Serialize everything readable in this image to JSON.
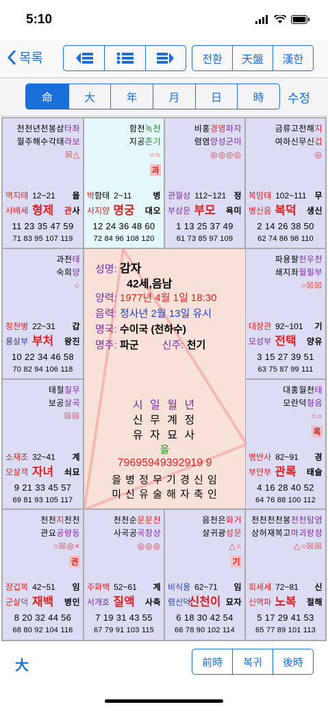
{
  "status": {
    "time": "5:10"
  },
  "nav": {
    "back_label": "목록",
    "right_buttons": [
      "전환",
      "天盤",
      "漢한"
    ]
  },
  "tabs": [
    "命",
    "大",
    "年",
    "月",
    "日",
    "時"
  ],
  "tab_selected": "命",
  "edit_label": "수정",
  "cells": [
    {
      "id": "c0",
      "stars1": [
        [
          "천천년천봉삼",
          "dark"
        ],
        [
          "타좌",
          "purple"
        ]
      ],
      "stars2": [
        [
          "월주해수각태",
          "dark"
        ],
        [
          "라보",
          "purple"
        ]
      ],
      "marks": "☒△",
      "badge": "",
      "left_top": [
        [
          "역지태",
          "red"
        ]
      ],
      "range": "12~21",
      "gan": "을",
      "left_bot": [
        [
          "사배세",
          "red"
        ]
      ],
      "palace": "형제",
      "palace_color": "red",
      "relation": [
        [
          "관",
          "red"
        ],
        [
          "사",
          "dark"
        ]
      ],
      "nums1": "11 23 35 47 59",
      "nums2": "71 83 95 107 119",
      "hl": false
    },
    {
      "id": "c1",
      "stars1": [
        [
          "함천",
          "dark"
        ],
        [
          "녹천",
          "green"
        ]
      ],
      "stars2": [
        [
          "지공",
          "dark"
        ],
        [
          "존기",
          "green"
        ]
      ],
      "marks": "○○",
      "badge": "과",
      "left_top": [
        [
          "박",
          "red"
        ],
        [
          "함태",
          "dark"
        ]
      ],
      "range": "2~11",
      "gan": "병",
      "left_bot": [
        [
          "사지양",
          "red"
        ]
      ],
      "palace": "명궁",
      "palace_color": "red",
      "relation": [
        [
          "대",
          "dark"
        ],
        [
          "오",
          "dark"
        ]
      ],
      "nums1": "12 24 36 48 60",
      "nums2": "72 84 96 108 120",
      "hl": true
    },
    {
      "id": "c2",
      "stars1": [
        [
          "비홍",
          "dark"
        ],
        [
          "경영",
          "red"
        ],
        [
          "파자",
          "purple"
        ]
      ],
      "stars2": [
        [
          "렴염",
          "dark"
        ],
        [
          "양성군미",
          "purple"
        ]
      ],
      "marks": "◎◎◎◎",
      "badge": "",
      "left_top": [
        [
          "관월상",
          "purple"
        ]
      ],
      "range": "112~121",
      "gan": "정",
      "left_bot": [
        [
          "부삼문",
          "purple"
        ]
      ],
      "palace": "부모",
      "palace_color": "red",
      "relation": [
        [
          "욕",
          "dark"
        ],
        [
          "미",
          "dark"
        ]
      ],
      "nums1": "1 13 25 37 49",
      "nums2": "61 73 85 97 109",
      "hl": false
    },
    {
      "id": "c3",
      "stars1": [
        [
          "금류고천해",
          "dark"
        ],
        [
          "지",
          "red"
        ]
      ],
      "stars2": [
        [
          "여하신무신",
          "dark"
        ],
        [
          "겁",
          "red"
        ]
      ],
      "marks": "◎",
      "badge": "",
      "left_top": [
        [
          "복망태",
          "red"
        ]
      ],
      "range": "102~111",
      "gan": "무",
      "left_bot": [
        [
          "병신음",
          "red"
        ]
      ],
      "palace": "복덕",
      "palace_color": "red",
      "relation": [
        [
          "생",
          "dark"
        ],
        [
          "신",
          "dark"
        ]
      ],
      "nums1": "2 14 26 38 50",
      "nums2": "62 74 86 98 110",
      "hl": false
    },
    {
      "id": "c4",
      "stars1": [
        [
          "과천",
          "dark"
        ],
        [
          "태",
          "purple"
        ]
      ],
      "stars2": [
        [
          "숙희",
          "dark"
        ],
        [
          "양",
          "purple"
        ]
      ],
      "marks": "○",
      "badge": "",
      "left_top": [
        [
          "청천병",
          "red"
        ]
      ],
      "range": "22~31",
      "gan": "갑",
      "left_bot": [
        [
          "룡살부",
          "blue"
        ]
      ],
      "palace": "부처",
      "palace_color": "red",
      "relation": [
        [
          "왕",
          "dark"
        ],
        [
          "진",
          "dark"
        ]
      ],
      "nums1": "10 22 34 46 58",
      "nums2": "70 82 94 106 118",
      "hl": false
    },
    {
      "id": "c5",
      "stars1": [
        [
          "파용팔",
          "dark"
        ],
        [
          "천우천",
          "purple"
        ]
      ],
      "stars2": [
        [
          "쇄지좌",
          "dark"
        ],
        [
          "월필부",
          "purple"
        ]
      ],
      "marks": "○☒☒",
      "badge": "",
      "left_top": [
        [
          "대장관",
          "red"
        ]
      ],
      "range": "92~101",
      "gan": "기",
      "left_bot": [
        [
          "모성부",
          "purple"
        ]
      ],
      "palace": "전택",
      "palace_color": "red",
      "relation": [
        [
          "양",
          "dark"
        ],
        [
          "유",
          "dark"
        ]
      ],
      "nums1": "3 15 27 39 51",
      "nums2": "63 75 87 99 111",
      "hl": false
    },
    {
      "id": "c6",
      "stars1": [
        [
          "태절",
          "dark"
        ],
        [
          "칠무",
          "purple"
        ]
      ],
      "stars2": [
        [
          "보공",
          "dark"
        ],
        [
          "살곡",
          "purple"
        ]
      ],
      "marks": "☒☒",
      "badge": "",
      "left_top": [
        [
          "소재조",
          "red"
        ]
      ],
      "range": "32~41",
      "gan": "계",
      "left_bot": [
        [
          "모살객",
          "red"
        ]
      ],
      "palace": "자녀",
      "palace_color": "red",
      "relation": [
        [
          "쇠",
          "dark"
        ],
        [
          "묘",
          "dark"
        ]
      ],
      "nums1": "9 21 33 45 57",
      "nums2": "69 81 93 105 117",
      "hl": false
    },
    {
      "id": "c7",
      "stars1": [
        [
          "대홍월천",
          "dark"
        ],
        [
          "태",
          "purple"
        ]
      ],
      "stars2": [
        [
          "모란덕",
          "dark"
        ],
        [
          "형음",
          "purple"
        ]
      ],
      "marks": "○○",
      "badge": "록",
      "left_top": [
        [
          "병반사",
          "red"
        ]
      ],
      "range": "82~91",
      "gan": "경",
      "left_bot": [
        [
          "부안부",
          "red"
        ]
      ],
      "palace": "관록",
      "palace_color": "red",
      "relation": [
        [
          "태",
          "dark"
        ],
        [
          "술",
          "dark"
        ]
      ],
      "nums1": "4 16 28 40 52",
      "nums2": "64 76 88 100 112",
      "hl": false
    },
    {
      "id": "c8",
      "stars1": [
        [
          "천천",
          "dark"
        ],
        [
          "지",
          "red"
        ],
        [
          "천천",
          "dark"
        ]
      ],
      "stars2": [
        [
          "관요",
          "dark"
        ],
        [
          "공량동",
          "purple"
        ]
      ],
      "marks": "○☒◎×",
      "badge": "권",
      "left_top": [
        [
          "장겁복",
          "red"
        ]
      ],
      "range": "42~51",
      "gan": "임",
      "left_bot": [
        [
          "군살덕",
          "red"
        ]
      ],
      "palace": "재백",
      "palace_color": "red",
      "relation": [
        [
          "병",
          "dark"
        ],
        [
          "인",
          "dark"
        ]
      ],
      "nums1": "8 20 32 44 56",
      "nums2": "68 80 92 104 116",
      "hl": false
    },
    {
      "id": "c9",
      "stars1": [
        [
          "천천순",
          "dark"
        ],
        [
          "문문천",
          "red"
        ]
      ],
      "stars2": [
        [
          "사곡공",
          "dark"
        ],
        [
          "곡창상",
          "purple"
        ]
      ],
      "marks": "◎◎◎",
      "badge": "",
      "left_top": [
        [
          "주화백",
          "red"
        ]
      ],
      "range": "52~61",
      "gan": "계",
      "left_bot": [
        [
          "서개호",
          "purple"
        ]
      ],
      "palace": "질액",
      "palace_color": "red",
      "relation": [
        [
          "사",
          "dark"
        ],
        [
          "축",
          "dark"
        ]
      ],
      "nums1": "7 19 31 43 55",
      "nums2": "67 79 91 103 115",
      "hl": false
    },
    {
      "id": "c10",
      "stars1": [
        [
          "음천은",
          "dark"
        ],
        [
          "화거",
          "red"
        ]
      ],
      "stars2": [
        [
          "살귀광",
          "dark"
        ],
        [
          "성문",
          "red"
        ]
      ],
      "marks": "△○",
      "badge": "기",
      "left_top": [
        [
          "비식용",
          "blue"
        ]
      ],
      "range": "62~71",
      "gan": "임",
      "left_bot": [
        [
          "렴신덕",
          "blue"
        ]
      ],
      "palace": "신천이",
      "palace_color": "blue",
      "relation": [
        [
          "묘",
          "dark"
        ],
        [
          "자",
          "dark"
        ]
      ],
      "nums1": "6 18 30 42 54",
      "nums2": "66 78 90 102 114",
      "hl": false
    },
    {
      "id": "c11",
      "stars1": [
        [
          "천천천천봉",
          "dark"
        ],
        [
          "천천탐염",
          "purple"
        ]
      ],
      "stars2": [
        [
          "상허재복고",
          "dark"
        ],
        [
          "마괴랑정",
          "purple"
        ]
      ],
      "marks": "△○☒☒",
      "badge": "",
      "left_top": [
        [
          "희세세",
          "red"
        ]
      ],
      "range": "72~81",
      "gan": "신",
      "left_bot": [
        [
          "신역파",
          "red"
        ]
      ],
      "palace": "노복",
      "palace_color": "red",
      "relation": [
        [
          "절",
          "dark"
        ],
        [
          "해",
          "dark"
        ]
      ],
      "nums1": "5 17 29 41 53",
      "nums2": "65 77 89 101 113",
      "hl": false
    }
  ],
  "center": {
    "name_label": "성명:",
    "name": "감자",
    "age": "42세,음남",
    "solar_label": "양력:",
    "solar": "1977년 4월 1일 18:30",
    "lunar_label": "음력:",
    "lunar": "정사년 2월 13일 유시",
    "guk_label": "명국:",
    "guk": "수이국 (천하수)",
    "mj_label": "명주:",
    "mj": "파군",
    "sj_label": "신주:",
    "sj": "천기",
    "pillar_header": "시 일 월 년",
    "pillar_gan": "신 무 계 정",
    "pillar_ji": "유 자 묘 사",
    "eum": "을",
    "daeun_nums": "79695949392919 9",
    "daeun_gan": "을 병 정 무 기 경 신 임",
    "daeun_ji": "미 신 유 술 해 자 축 인"
  },
  "bottom": {
    "left_label": "大",
    "buttons": [
      "前時",
      "복귀",
      "後時"
    ]
  }
}
